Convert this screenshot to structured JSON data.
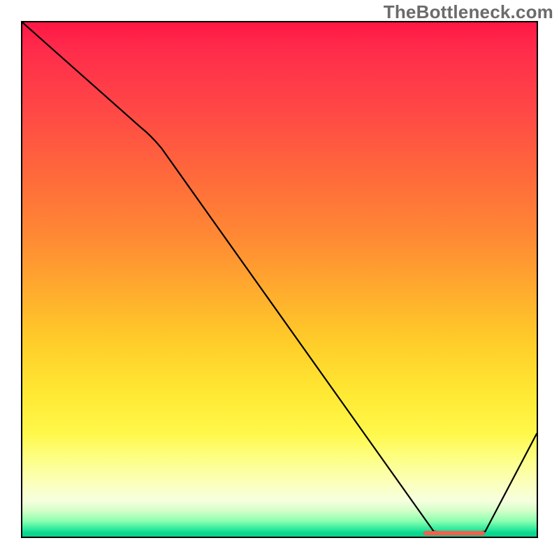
{
  "watermark": "TheBottleneck.com",
  "chart_data": {
    "type": "line",
    "title": "",
    "xlabel": "",
    "ylabel": "",
    "x_range": [
      0,
      100
    ],
    "y_range": [
      0,
      100
    ],
    "x": [
      0,
      25,
      80,
      90,
      100
    ],
    "values": [
      100,
      78,
      1,
      1,
      20
    ],
    "optimum_band_x": [
      78,
      90
    ],
    "background_gradient": {
      "stops": [
        {
          "pos": 0.0,
          "color": "#ff1744"
        },
        {
          "pos": 0.5,
          "color": "#ffb92e"
        },
        {
          "pos": 0.8,
          "color": "#fff84a"
        },
        {
          "pos": 0.95,
          "color": "#d3ffc8"
        },
        {
          "pos": 1.0,
          "color": "#0bd08c"
        }
      ]
    },
    "annotations": [
      "optimum-band-marker"
    ]
  }
}
